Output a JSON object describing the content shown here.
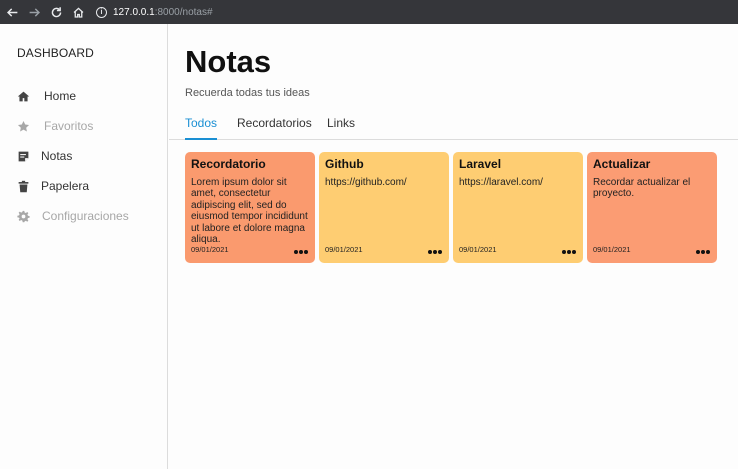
{
  "browser": {
    "url_host": "127.0.0.1",
    "url_rest": ":8000/notas#"
  },
  "sidebar": {
    "title": "DASHBOARD",
    "items": [
      {
        "label": "Home",
        "icon": "home-icon"
      },
      {
        "label": "Favoritos",
        "icon": "star-icon"
      },
      {
        "label": "Notas",
        "icon": "note-icon"
      },
      {
        "label": "Papelera",
        "icon": "trash-icon"
      },
      {
        "label": "Configuraciones",
        "icon": "gear-icon"
      }
    ]
  },
  "header": {
    "title": "Notas",
    "subtitle": "Recuerda todas tus ideas"
  },
  "tabs": [
    {
      "label": "Todos",
      "active": true
    },
    {
      "label": "Recordatorios",
      "active": false
    },
    {
      "label": "Links",
      "active": false
    }
  ],
  "cards": [
    {
      "title": "Recordatorio",
      "body": "Lorem ipsum dolor sit amet, consectetur adipiscing elit, sed do eiusmod tempor incididunt ut labore et dolore magna aliqua.",
      "date": "09/01/2021",
      "color": "#fa9a6e"
    },
    {
      "title": "Github",
      "body": "https://github.com/",
      "date": "09/01/2021",
      "color": "#fecd72"
    },
    {
      "title": "Laravel",
      "body": "https://laravel.com/",
      "date": "09/01/2021",
      "color": "#fecd72"
    },
    {
      "title": "Actualizar",
      "body": "Recordar actualizar el proyecto.",
      "date": "09/01/2021",
      "color": "#fb9c73"
    }
  ],
  "colors": {
    "accent": "#1a8fd3",
    "browser_bar": "#35363a"
  }
}
